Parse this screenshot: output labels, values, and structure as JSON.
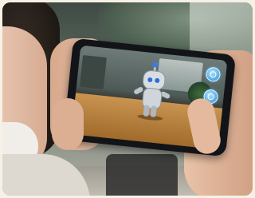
{
  "scene": {
    "subject": "person",
    "device": "smartphone",
    "ar_character": "robot",
    "colors": {
      "accent": "#2f8fd6",
      "tabletop": "#b9853f"
    }
  },
  "ar_controls": [
    {
      "icon": "ar-control-icon"
    },
    {
      "icon": "ar-control-icon"
    },
    {
      "icon": "ar-control-icon"
    },
    {
      "icon": "ar-control-icon"
    }
  ]
}
